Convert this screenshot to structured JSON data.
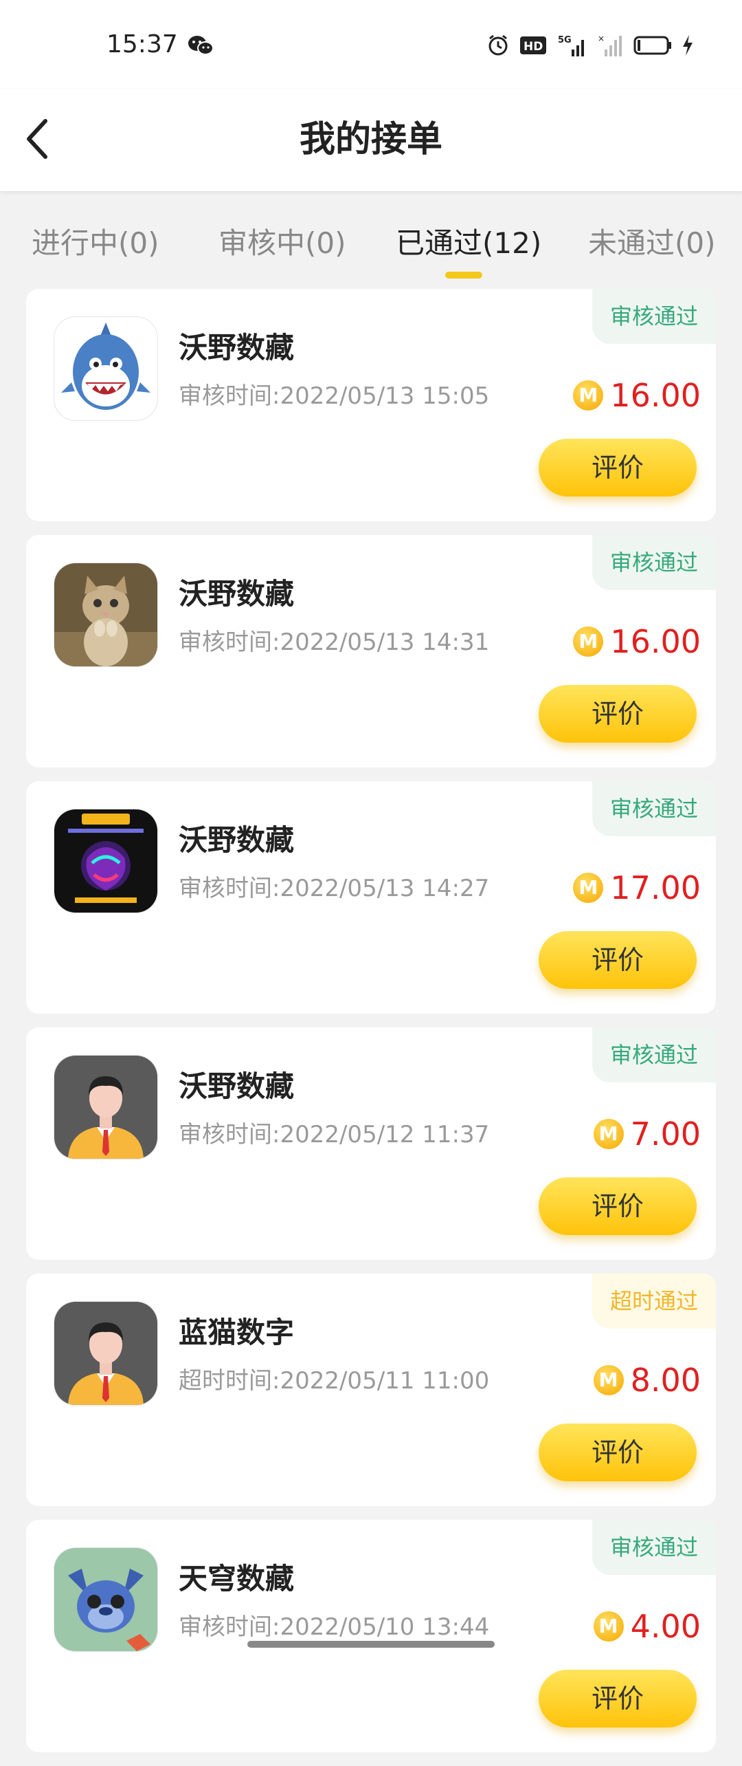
{
  "status_bar": {
    "time": "15:37",
    "icons": [
      "wechat-icon",
      "alarm-icon",
      "hd-icon",
      "signal-5g-icon",
      "signal-icon",
      "battery-icon",
      "charging-icon"
    ]
  },
  "header": {
    "title": "我的接单",
    "back_icon": "back-arrow-icon"
  },
  "tabs": [
    {
      "label": "进行中(0)",
      "active": false
    },
    {
      "label": "审核中(0)",
      "active": false
    },
    {
      "label": "已通过(12)",
      "active": true
    },
    {
      "label": "未通过(0)",
      "active": false
    }
  ],
  "colors": {
    "accent": "#f4c81c",
    "price": "#e02020",
    "status_pass": "#36a97b",
    "status_timeout": "#f2b62a"
  },
  "orders": [
    {
      "thumb": "shark-avatar",
      "name": "沃野数藏",
      "time": "审核时间:2022/05/13 15:05",
      "status": "审核通过",
      "status_type": "pass",
      "coin": "M",
      "price": "16.00",
      "action": "评价"
    },
    {
      "thumb": "cat-avatar",
      "name": "沃野数藏",
      "time": "审核时间:2022/05/13 14:31",
      "status": "审核通过",
      "status_type": "pass",
      "coin": "M",
      "price": "16.00",
      "action": "评价"
    },
    {
      "thumb": "nft-art-avatar",
      "name": "沃野数藏",
      "time": "审核时间:2022/05/13 14:27",
      "status": "审核通过",
      "status_type": "pass",
      "coin": "M",
      "price": "17.00",
      "action": "评价"
    },
    {
      "thumb": "default-user-avatar",
      "name": "沃野数藏",
      "time": "审核时间:2022/05/12 11:37",
      "status": "审核通过",
      "status_type": "pass",
      "coin": "M",
      "price": "7.00",
      "action": "评价"
    },
    {
      "thumb": "default-user-avatar",
      "name": "蓝猫数字",
      "time": "超时时间:2022/05/11 11:00",
      "status": "超时通过",
      "status_type": "timeout",
      "coin": "M",
      "price": "8.00",
      "action": "评价"
    },
    {
      "thumb": "stitch-avatar",
      "name": "天穹数藏",
      "time": "审核时间:2022/05/10 13:44",
      "status": "审核通过",
      "status_type": "pass",
      "coin": "M",
      "price": "4.00",
      "action": "评价"
    }
  ]
}
